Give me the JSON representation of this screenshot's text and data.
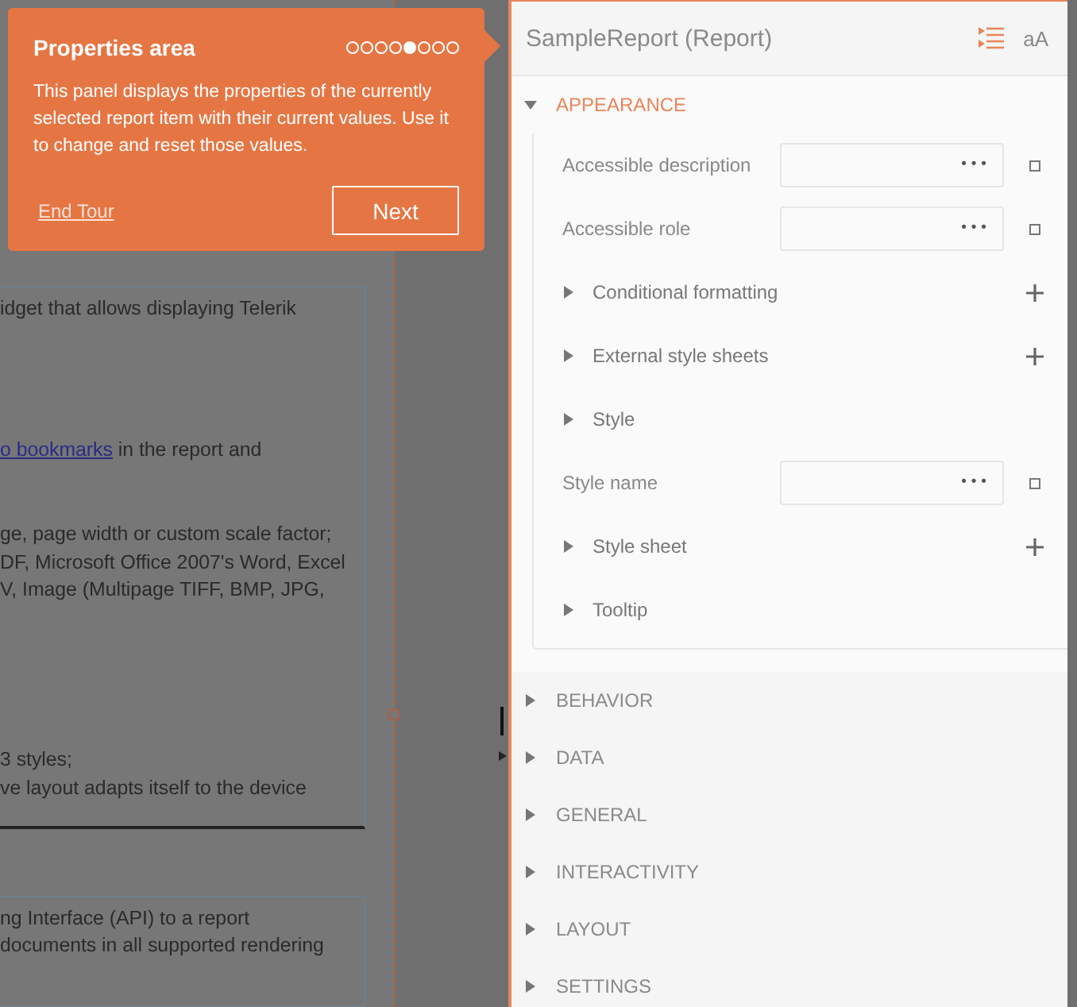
{
  "report_canvas": {
    "cards": [
      {
        "lines": [
          {
            "segments": [
              {
                "kind": "text",
                "text": "idget that allows displaying Telerik"
              }
            ]
          },
          {
            "segments": [
              {
                "kind": "link",
                "text": "o bookmarks"
              },
              {
                "kind": "text",
                "text": " in the report and"
              }
            ]
          },
          {
            "segments": [
              {
                "kind": "text",
                "text": "ge, page width or custom scale factor;"
              }
            ]
          },
          {
            "segments": [
              {
                "kind": "text",
                "text": "DF, Microsoft Office 2007's Word, Excel"
              }
            ]
          },
          {
            "segments": [
              {
                "kind": "text",
                "text": "V, Image (Multipage TIFF, BMP, JPG,"
              }
            ]
          },
          {
            "segments": [
              {
                "kind": "text",
                "text": "3 styles;"
              }
            ]
          },
          {
            "segments": [
              {
                "kind": "text",
                "text": "ve layout adapts itself to the device"
              }
            ]
          }
        ]
      },
      {
        "lines": [
          {
            "segments": [
              {
                "kind": "text",
                "text": "ng Interface (API) to a report"
              }
            ]
          },
          {
            "segments": [
              {
                "kind": "text",
                "text": "documents in all supported rendering"
              }
            ]
          }
        ]
      }
    ]
  },
  "tour_tip": {
    "title": "Properties area",
    "steps": [
      {
        "selected": false
      },
      {
        "selected": false
      },
      {
        "selected": false
      },
      {
        "selected": false
      },
      {
        "selected": true
      },
      {
        "selected": false
      },
      {
        "selected": false
      },
      {
        "selected": false
      }
    ],
    "body": "This panel displays the properties of the currently selected report item with their current values. Use it to change and reset those values.",
    "end_link": "End Tour",
    "next_button": "Next"
  },
  "properties": {
    "title": "SampleReport (Report)",
    "font_toggle": "aA",
    "categories": [
      {
        "name": "APPEARANCE",
        "expanded": true,
        "items": [
          {
            "kind": "field",
            "label": "Accessible description",
            "button": "•••"
          },
          {
            "kind": "field",
            "label": "Accessible role",
            "button": "•••"
          },
          {
            "kind": "group",
            "label": "Conditional formatting",
            "addable": true
          },
          {
            "kind": "group",
            "label": "External style sheets",
            "addable": true
          },
          {
            "kind": "group",
            "label": "Style",
            "addable": false
          },
          {
            "kind": "field",
            "label": "Style name",
            "button": "•••"
          },
          {
            "kind": "group",
            "label": "Style sheet",
            "addable": true
          },
          {
            "kind": "group",
            "label": "Tooltip",
            "addable": false
          }
        ]
      },
      {
        "name": "BEHAVIOR",
        "expanded": false
      },
      {
        "name": "DATA",
        "expanded": false
      },
      {
        "name": "GENERAL",
        "expanded": false
      },
      {
        "name": "INTERACTIVITY",
        "expanded": false
      },
      {
        "name": "LAYOUT",
        "expanded": false
      },
      {
        "name": "SETTINGS",
        "expanded": false
      }
    ]
  }
}
